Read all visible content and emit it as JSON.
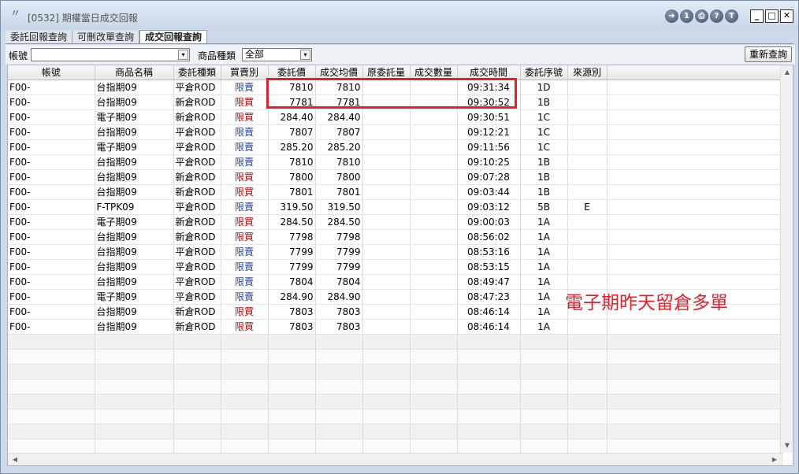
{
  "window": {
    "title": "[0532] 期權當日成交回報",
    "toolbar_icons": [
      "exit-icon",
      "info-icon",
      "print-icon",
      "help-icon",
      "topmost-icon"
    ],
    "toolbar_glyphs": [
      "➔",
      "1",
      "⎙",
      "?",
      "T"
    ],
    "min_glyph": "_",
    "max_glyph": "□",
    "close_glyph": "✕"
  },
  "tabs": [
    "委託回報查詢",
    "可刪改單查詢",
    "成交回報查詢"
  ],
  "active_tab": 2,
  "filter": {
    "account_label": "帳號",
    "account_value": "",
    "product_type_label": "商品種類",
    "product_type_value": "全部",
    "dropdown_glyph": "▾",
    "refresh_label": "重新查詢"
  },
  "columns": [
    "帳號",
    "商品名稱",
    "委託種類",
    "買賣別",
    "委託價",
    "成交均價",
    "原委託量",
    "成交數量",
    "成交時間",
    "委託序號",
    "來源別"
  ],
  "rows": [
    {
      "account": "F00-",
      "product": "台指期09",
      "order_type": "平倉ROD",
      "side": "限賣",
      "price": "7810",
      "avg_price": "7810",
      "orig_qty": "",
      "fill_qty": "",
      "time": "09:31:34",
      "seq": "1D",
      "source": ""
    },
    {
      "account": "F00-",
      "product": "台指期09",
      "order_type": "新倉ROD",
      "side": "限買",
      "price": "7781",
      "avg_price": "7781",
      "orig_qty": "",
      "fill_qty": "",
      "time": "09:30:52",
      "seq": "1B",
      "source": ""
    },
    {
      "account": "F00-",
      "product": "電子期09",
      "order_type": "新倉ROD",
      "side": "限買",
      "price": "284.40",
      "avg_price": "284.40",
      "orig_qty": "",
      "fill_qty": "",
      "time": "09:30:51",
      "seq": "1C",
      "source": ""
    },
    {
      "account": "F00-",
      "product": "台指期09",
      "order_type": "平倉ROD",
      "side": "限賣",
      "price": "7807",
      "avg_price": "7807",
      "orig_qty": "",
      "fill_qty": "",
      "time": "09:12:21",
      "seq": "1C",
      "source": ""
    },
    {
      "account": "F00-",
      "product": "電子期09",
      "order_type": "平倉ROD",
      "side": "限賣",
      "price": "285.20",
      "avg_price": "285.20",
      "orig_qty": "",
      "fill_qty": "",
      "time": "09:11:56",
      "seq": "1C",
      "source": ""
    },
    {
      "account": "F00-",
      "product": "台指期09",
      "order_type": "平倉ROD",
      "side": "限賣",
      "price": "7810",
      "avg_price": "7810",
      "orig_qty": "",
      "fill_qty": "",
      "time": "09:10:25",
      "seq": "1B",
      "source": ""
    },
    {
      "account": "F00-",
      "product": "台指期09",
      "order_type": "新倉ROD",
      "side": "限買",
      "price": "7800",
      "avg_price": "7800",
      "orig_qty": "",
      "fill_qty": "",
      "time": "09:07:28",
      "seq": "1B",
      "source": ""
    },
    {
      "account": "F00-",
      "product": "台指期09",
      "order_type": "新倉ROD",
      "side": "限買",
      "price": "7801",
      "avg_price": "7801",
      "orig_qty": "",
      "fill_qty": "",
      "time": "09:03:44",
      "seq": "1B",
      "source": ""
    },
    {
      "account": "F00-",
      "product": "F-TPK09",
      "order_type": "平倉ROD",
      "side": "限賣",
      "price": "319.50",
      "avg_price": "319.50",
      "orig_qty": "",
      "fill_qty": "",
      "time": "09:03:12",
      "seq": "5B",
      "source": "E"
    },
    {
      "account": "F00-",
      "product": "電子期09",
      "order_type": "新倉ROD",
      "side": "限買",
      "price": "284.50",
      "avg_price": "284.50",
      "orig_qty": "",
      "fill_qty": "",
      "time": "09:00:03",
      "seq": "1A",
      "source": ""
    },
    {
      "account": "F00-",
      "product": "台指期09",
      "order_type": "新倉ROD",
      "side": "限買",
      "price": "7798",
      "avg_price": "7798",
      "orig_qty": "",
      "fill_qty": "",
      "time": "08:56:02",
      "seq": "1A",
      "source": ""
    },
    {
      "account": "F00-",
      "product": "台指期09",
      "order_type": "平倉ROD",
      "side": "限賣",
      "price": "7799",
      "avg_price": "7799",
      "orig_qty": "",
      "fill_qty": "",
      "time": "08:53:16",
      "seq": "1A",
      "source": ""
    },
    {
      "account": "F00-",
      "product": "台指期09",
      "order_type": "平倉ROD",
      "side": "限賣",
      "price": "7799",
      "avg_price": "7799",
      "orig_qty": "",
      "fill_qty": "",
      "time": "08:53:15",
      "seq": "1A",
      "source": ""
    },
    {
      "account": "F00-",
      "product": "台指期09",
      "order_type": "平倉ROD",
      "side": "限賣",
      "price": "7804",
      "avg_price": "7804",
      "orig_qty": "",
      "fill_qty": "",
      "time": "08:49:47",
      "seq": "1A",
      "source": ""
    },
    {
      "account": "F00-",
      "product": "電子期09",
      "order_type": "平倉ROD",
      "side": "限賣",
      "price": "284.90",
      "avg_price": "284.90",
      "orig_qty": "",
      "fill_qty": "",
      "time": "08:47:23",
      "seq": "1A",
      "source": ""
    },
    {
      "account": "F00-",
      "product": "台指期09",
      "order_type": "新倉ROD",
      "side": "限買",
      "price": "7803",
      "avg_price": "7803",
      "orig_qty": "",
      "fill_qty": "",
      "time": "08:46:14",
      "seq": "1A",
      "source": ""
    },
    {
      "account": "F00-",
      "product": "台指期09",
      "order_type": "新倉ROD",
      "side": "限買",
      "price": "7803",
      "avg_price": "7803",
      "orig_qty": "",
      "fill_qty": "",
      "time": "08:46:14",
      "seq": "1A",
      "source": ""
    }
  ],
  "empty_row_count": 9,
  "scroll_glyphs": {
    "up": "▲",
    "down": "▼",
    "left": "◀",
    "right": "▶"
  },
  "annotation": "電子期昨天留倉多單",
  "colors": {
    "buy": "#c00000",
    "sell": "#1f3fa0",
    "annotation": "#e0212b",
    "highlight": "#e0212b"
  }
}
